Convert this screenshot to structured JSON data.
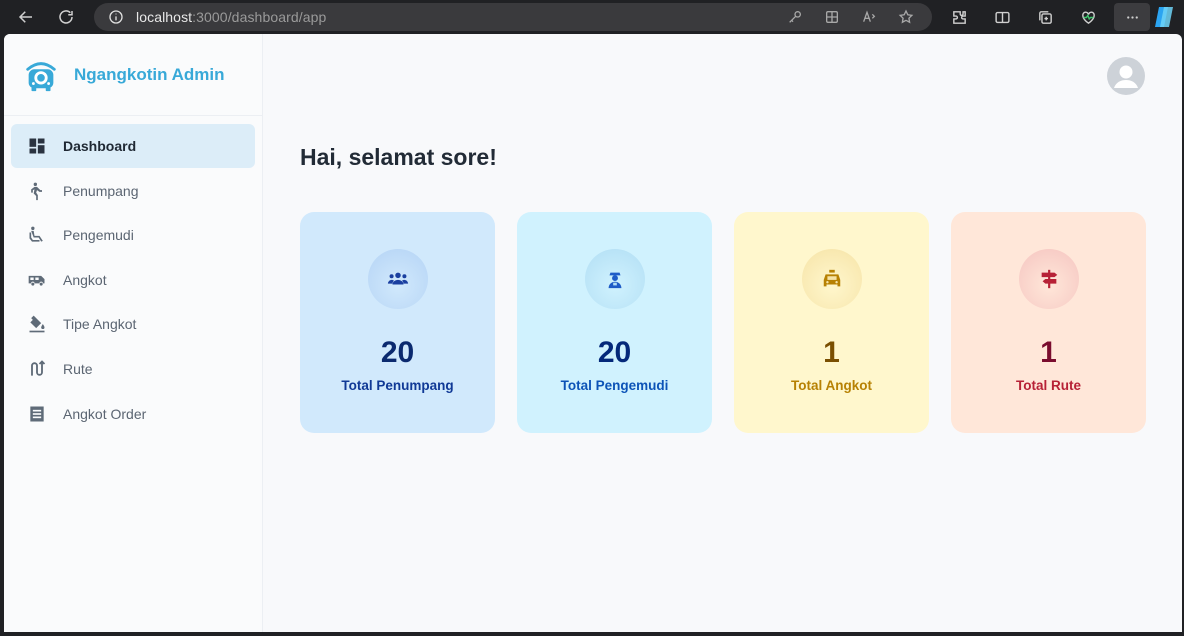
{
  "browser": {
    "url_host": "localhost",
    "url_path": ":3000/dashboard/app"
  },
  "sidebar": {
    "brand": "Ngangkotin Admin",
    "items": [
      {
        "label": "Dashboard",
        "icon": "dashboard-icon",
        "active": true
      },
      {
        "label": "Penumpang",
        "icon": "walking-person-icon"
      },
      {
        "label": "Pengemudi",
        "icon": "seated-driver-icon"
      },
      {
        "label": "Angkot",
        "icon": "van-icon"
      },
      {
        "label": "Tipe Angkot",
        "icon": "paint-bucket-icon"
      },
      {
        "label": "Rute",
        "icon": "route-icon"
      },
      {
        "label": "Angkot Order",
        "icon": "receipt-icon"
      }
    ]
  },
  "main": {
    "greeting": "Hai, selamat sore!",
    "cards": [
      {
        "value": "20",
        "label": "Total Penumpang",
        "icon": "group-icon",
        "bg": "#d1e9fc",
        "circle": "#b4d3f5",
        "value_color": "#0b2a6f",
        "label_color": "#103996",
        "icon_color": "#1a3fa0"
      },
      {
        "value": "20",
        "label": "Total Pengemudi",
        "icon": "driver-icon",
        "bg": "#d0f2fe",
        "circle": "#b1def4",
        "value_color": "#04297a",
        "label_color": "#0c53b7",
        "icon_color": "#1e5cc7"
      },
      {
        "value": "1",
        "label": "Total Angkot",
        "icon": "taxi-icon",
        "bg": "#fff7cd",
        "circle": "#f6e3a6",
        "value_color": "#7a4f01",
        "label_color": "#b78103",
        "icon_color": "#b78103"
      },
      {
        "value": "1",
        "label": "Total Rute",
        "icon": "signpost-icon",
        "bg": "#ffe7d9",
        "circle": "#f5c4c0",
        "value_color": "#7a0c2e",
        "label_color": "#b72136",
        "icon_color": "#b72136"
      }
    ]
  }
}
